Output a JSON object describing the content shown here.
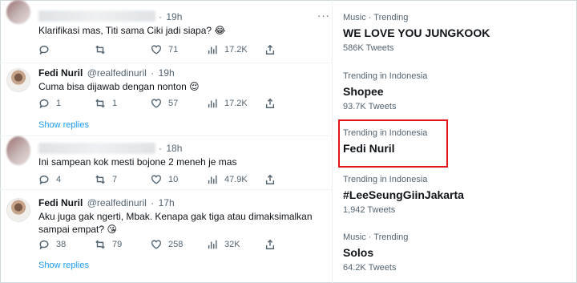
{
  "tweets": [
    {
      "time": "19h",
      "text": "Klarifikasi mas, Titi sama Ciki jadi siapa? 😂",
      "reply": "",
      "retweet": "",
      "like": "71",
      "views": "17.2K"
    },
    {
      "name": "Fedi Nuril",
      "handle": "@realfedinuril",
      "time": "19h",
      "text": "Cuma bisa dijawab dengan nonton 😌",
      "reply": "1",
      "retweet": "1",
      "like": "57",
      "views": "17.2K",
      "show_replies": "Show replies"
    },
    {
      "time": "18h",
      "text": "Ini sampean kok mesti bojone 2 meneh je mas",
      "reply": "4",
      "retweet": "7",
      "like": "10",
      "views": "47.9K"
    },
    {
      "name": "Fedi Nuril",
      "handle": "@realfedinuril",
      "time": "17h",
      "text": "Aku juga gak ngerti, Mbak. Kenapa gak tiga atau dimaksimalkan sampai empat? 😘",
      "reply": "38",
      "retweet": "79",
      "like": "258",
      "views": "32K",
      "show_replies": "Show replies"
    }
  ],
  "trends": [
    {
      "context": "Music · Trending",
      "name": "WE LOVE YOU JUNGKOOK",
      "count": "586K Tweets"
    },
    {
      "context": "Trending in Indonesia",
      "name": "Shopee",
      "count": "93.7K Tweets"
    },
    {
      "context": "Trending in Indonesia",
      "name": "Fedi Nuril",
      "count": ""
    },
    {
      "context": "Trending in Indonesia",
      "name": "#LeeSeungGiinJakarta",
      "count": "1,942 Tweets"
    },
    {
      "context": "Music · Trending",
      "name": "Solos",
      "count": "64.2K Tweets"
    }
  ],
  "more_glyph": "···",
  "colors": {
    "accent": "#1d9bf0",
    "highlight": "#e3151a",
    "muted": "#536471"
  },
  "icons": [
    "reply-icon",
    "retweet-icon",
    "like-icon",
    "views-icon",
    "share-icon",
    "more-icon"
  ]
}
